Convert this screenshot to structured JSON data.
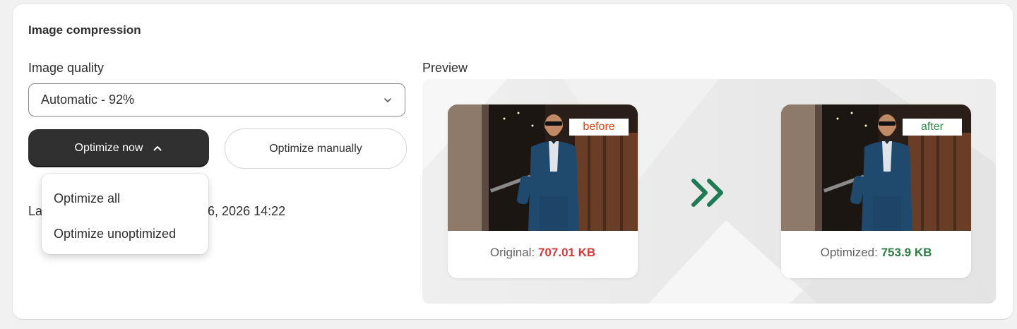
{
  "section": {
    "title": "Image compression"
  },
  "quality": {
    "label": "Image quality",
    "selected": "Automatic - 92%"
  },
  "actions": {
    "optimize_now_label": "Optimize now",
    "optimize_manually_label": "Optimize manually"
  },
  "last_optimized": {
    "prefix": "La",
    "suffix": "6, 2026 14:22"
  },
  "dropdown": {
    "items": [
      "Optimize all",
      "Optimize unoptimized"
    ]
  },
  "preview": {
    "label": "Preview",
    "before": {
      "tag": "before",
      "size_label": "Original: ",
      "size_value": "707.01 KB"
    },
    "after": {
      "tag": "after",
      "size_label": "Optimized: ",
      "size_value": "753.9 KB"
    }
  },
  "colors": {
    "before_tag": "#e0440e",
    "after_tag": "#2e8b4a",
    "original_size": "#d13a3a",
    "optimized_size": "#2e7d46",
    "arrow": "#1f7a55"
  },
  "icons": {
    "select_chevron": "chevron-down-icon",
    "button_chevron": "chevron-up-icon",
    "preview_arrow": "double-chevron-right-icon"
  }
}
